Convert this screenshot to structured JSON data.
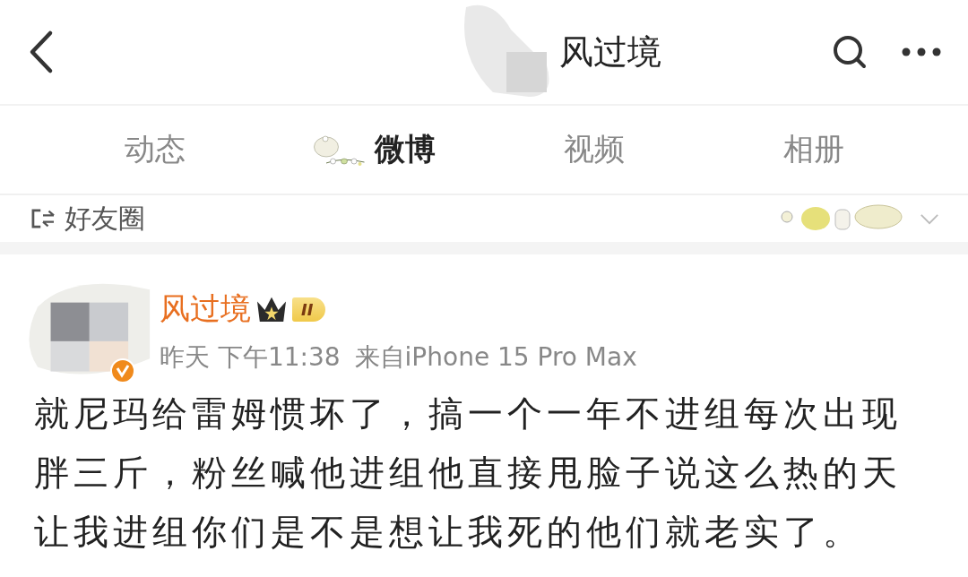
{
  "header": {
    "title": "风过境"
  },
  "tabs": [
    {
      "label": "动态",
      "selected": false
    },
    {
      "label": "微博",
      "selected": true
    },
    {
      "label": "视频",
      "selected": false
    },
    {
      "label": "相册",
      "selected": false
    }
  ],
  "filter": {
    "label": "好友圈"
  },
  "post": {
    "author": "风过境",
    "level_badge": "II",
    "verified": true,
    "time": "昨天 下午11:38",
    "source": "来自iPhone 15 Pro Max",
    "text": "就尼玛给雷姆惯坏了，搞一个一年不进组每次出现胖三斤，粉丝喊他进组他直接甩脸子说这么热的天让我进组你们是不是想让我死的他们就老实了。"
  }
}
